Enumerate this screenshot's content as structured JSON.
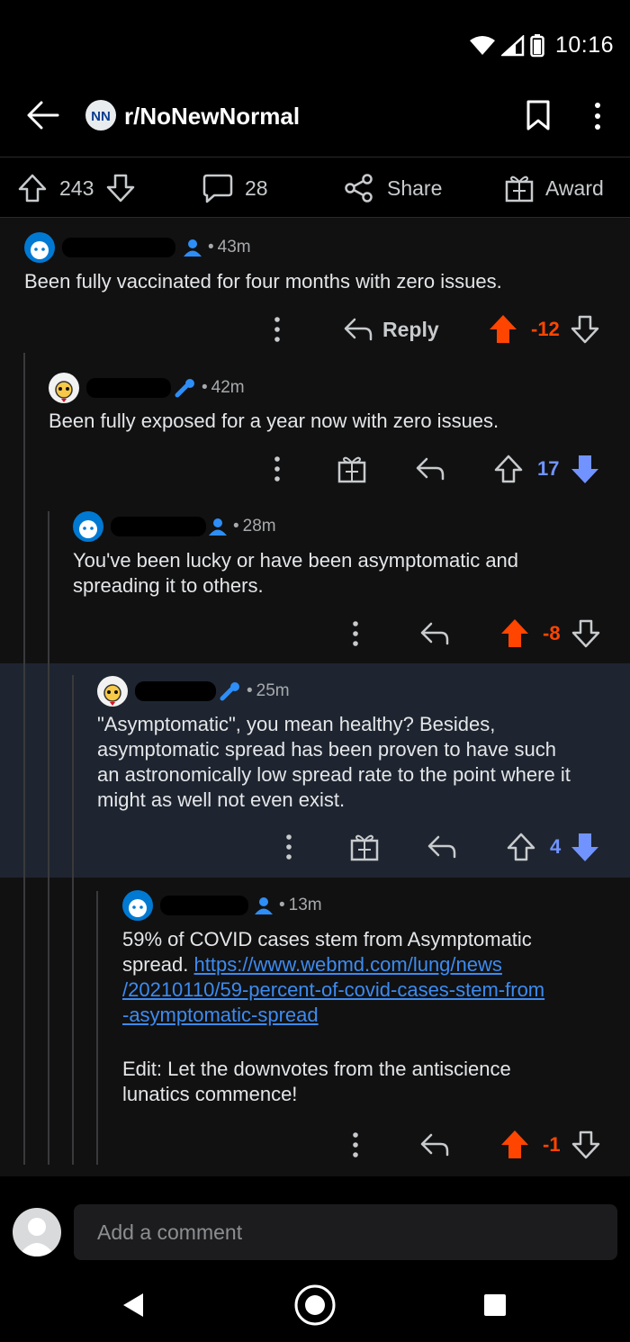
{
  "status": {
    "time": "10:16"
  },
  "header": {
    "subreddit": "r/NoNewNormal"
  },
  "actions": {
    "upvotes": "243",
    "comments": "28",
    "share": "Share",
    "award": "Award"
  },
  "comments": [
    {
      "age": "43m",
      "text": "Been fully vaccinated for four months with zero issues.",
      "score": "-12",
      "reply": "Reply"
    },
    {
      "age": "42m",
      "text": "Been fully exposed for a year now with zero issues.",
      "score": "17"
    },
    {
      "age": "28m",
      "text_line1": "You've been lucky or have been asymptomatic and",
      "text_line2": "spreading it to others.",
      "score": "-8"
    },
    {
      "age": "25m",
      "text_line1": "\"Asymptomatic\", you mean healthy? Besides,",
      "text_line2": "asymptomatic spread has been proven to have such",
      "text_line3": "an astronomically low spread rate to the point where it",
      "text_line4": "might as well not even exist.",
      "score": "4"
    },
    {
      "age": "13m",
      "text_line1": "59% of COVID cases stem from Asymptomatic",
      "text_line2_prefix": "spread.",
      "link_part1": "https://www.webmd.com/lung/news",
      "link_part2": "/20210110/59-percent-of-covid-cases-stem-from",
      "link_part3": "-asymptomatic-spread",
      "edit_line1": "Edit: Let the downvotes from the antiscience",
      "edit_line2": "lunatics commence!",
      "score": "-1"
    }
  ],
  "composer": {
    "placeholder": "Add a comment"
  },
  "colors": {
    "upvote": "#ff4500",
    "downvote": "#7193ff",
    "highlight": "#1e2530",
    "link": "#3d8bf0"
  }
}
